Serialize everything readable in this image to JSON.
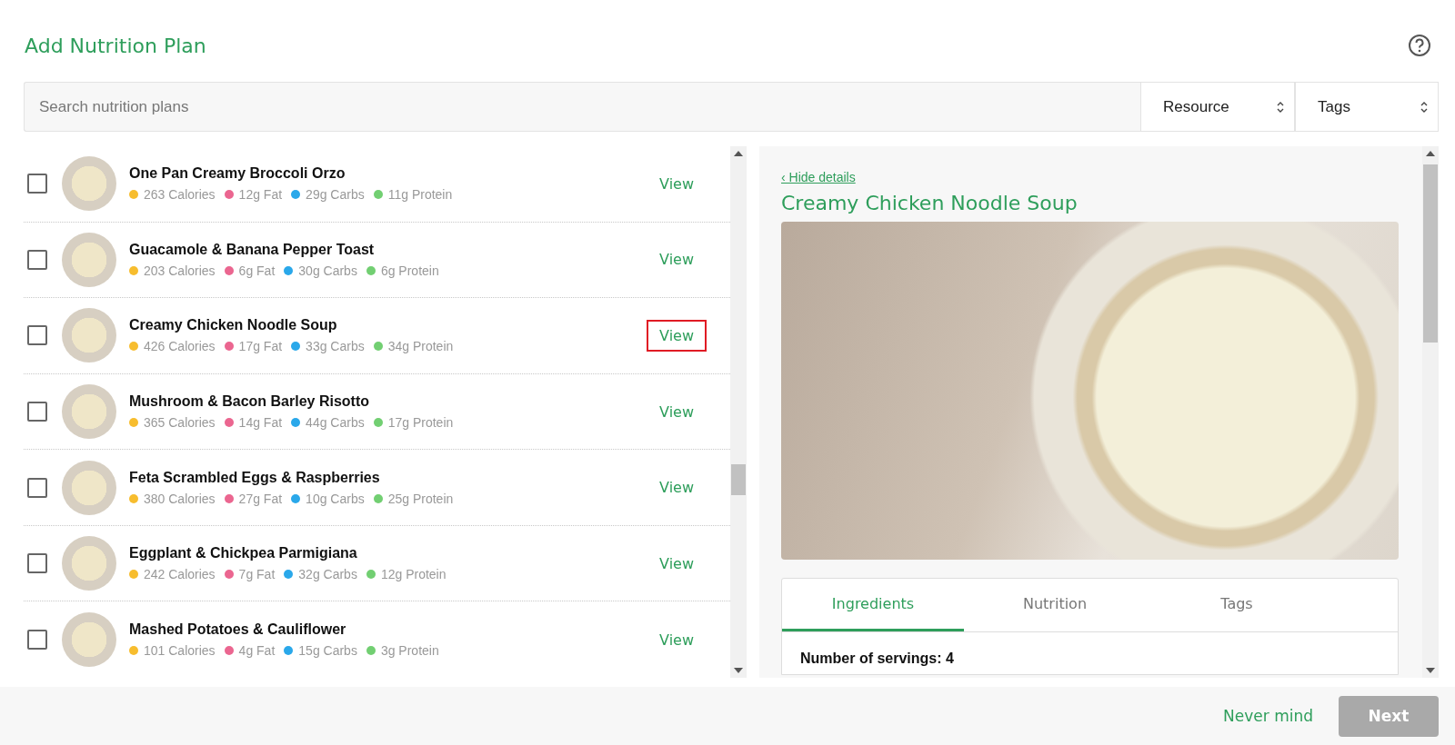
{
  "title": "Add Nutrition Plan",
  "search": {
    "placeholder": "Search nutrition plans"
  },
  "filters": [
    {
      "label": "Resource"
    },
    {
      "label": "Tags"
    }
  ],
  "recipes": [
    {
      "name": "One Pan Creamy Broccoli Orzo",
      "checked": false,
      "highlighted": false,
      "action": "View",
      "macros": [
        {
          "text": "263 Calories",
          "color": "#f7bd2e"
        },
        {
          "text": "12g Fat",
          "color": "#eb6690"
        },
        {
          "text": "29g Carbs",
          "color": "#2aa8ea"
        },
        {
          "text": "11g Protein",
          "color": "#72cf72"
        }
      ]
    },
    {
      "name": "Guacamole & Banana Pepper Toast",
      "checked": false,
      "highlighted": false,
      "action": "View",
      "macros": [
        {
          "text": "203 Calories",
          "color": "#f7bd2e"
        },
        {
          "text": "6g Fat",
          "color": "#eb6690"
        },
        {
          "text": "30g Carbs",
          "color": "#2aa8ea"
        },
        {
          "text": "6g Protein",
          "color": "#72cf72"
        }
      ]
    },
    {
      "name": "Creamy Chicken Noodle Soup",
      "checked": false,
      "highlighted": true,
      "action": "View",
      "macros": [
        {
          "text": "426 Calories",
          "color": "#f7bd2e"
        },
        {
          "text": "17g Fat",
          "color": "#eb6690"
        },
        {
          "text": "33g Carbs",
          "color": "#2aa8ea"
        },
        {
          "text": "34g Protein",
          "color": "#72cf72"
        }
      ]
    },
    {
      "name": "Mushroom & Bacon Barley Risotto",
      "checked": false,
      "highlighted": false,
      "action": "View",
      "macros": [
        {
          "text": "365 Calories",
          "color": "#f7bd2e"
        },
        {
          "text": "14g Fat",
          "color": "#eb6690"
        },
        {
          "text": "44g Carbs",
          "color": "#2aa8ea"
        },
        {
          "text": "17g Protein",
          "color": "#72cf72"
        }
      ]
    },
    {
      "name": "Feta Scrambled Eggs & Raspberries",
      "checked": false,
      "highlighted": false,
      "action": "View",
      "macros": [
        {
          "text": "380 Calories",
          "color": "#f7bd2e"
        },
        {
          "text": "27g Fat",
          "color": "#eb6690"
        },
        {
          "text": "10g Carbs",
          "color": "#2aa8ea"
        },
        {
          "text": "25g Protein",
          "color": "#72cf72"
        }
      ]
    },
    {
      "name": "Eggplant & Chickpea Parmigiana",
      "checked": false,
      "highlighted": false,
      "action": "View",
      "macros": [
        {
          "text": "242 Calories",
          "color": "#f7bd2e"
        },
        {
          "text": "7g Fat",
          "color": "#eb6690"
        },
        {
          "text": "32g Carbs",
          "color": "#2aa8ea"
        },
        {
          "text": "12g Protein",
          "color": "#72cf72"
        }
      ]
    },
    {
      "name": "Mashed Potatoes & Cauliflower",
      "checked": false,
      "highlighted": false,
      "action": "View",
      "macros": [
        {
          "text": "101 Calories",
          "color": "#f7bd2e"
        },
        {
          "text": "4g Fat",
          "color": "#eb6690"
        },
        {
          "text": "15g Carbs",
          "color": "#2aa8ea"
        },
        {
          "text": "3g Protein",
          "color": "#72cf72"
        }
      ]
    }
  ],
  "details": {
    "back_link": "‹ Hide details",
    "title": "Creamy Chicken Noodle Soup",
    "tabs": [
      {
        "label": "Ingredients",
        "selected": true
      },
      {
        "label": "Nutrition",
        "selected": false
      },
      {
        "label": "Tags",
        "selected": false
      }
    ],
    "servings": "Number of servings: 4"
  },
  "footer": {
    "cancel": "Never mind",
    "next": {
      "label": "Next",
      "disabled": true
    }
  }
}
